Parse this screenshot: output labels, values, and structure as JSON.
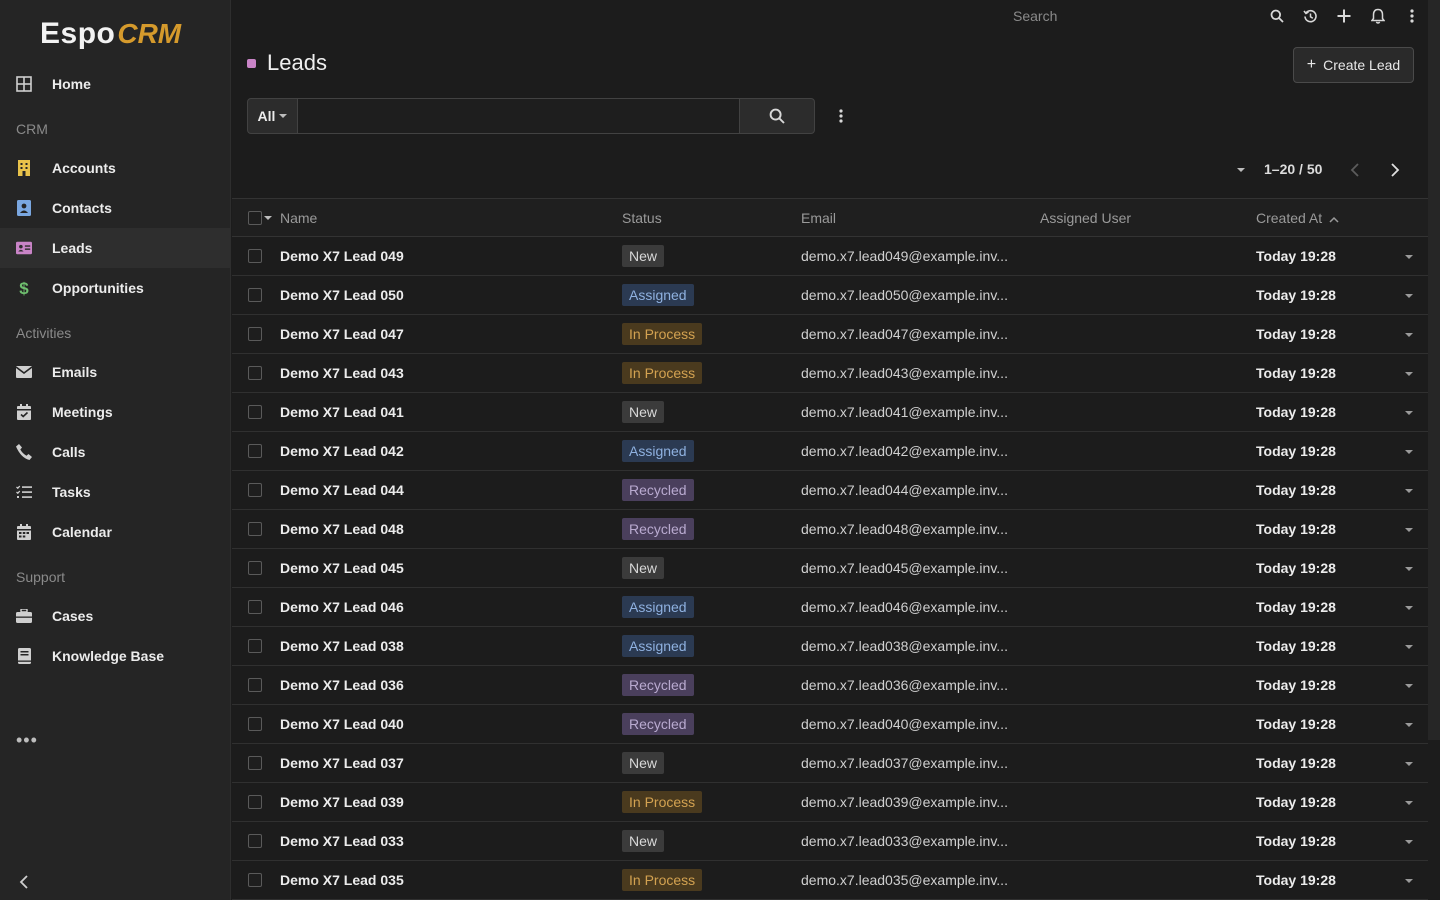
{
  "app": {
    "logo_main": "Espo",
    "logo_accent": "CRM"
  },
  "colors": {
    "accent": "#d59a2c",
    "leads_dot": "#c984c7",
    "accounts_icon": "#e8c24a",
    "contacts_icon": "#7aa7e0",
    "leads_icon": "#c984c7",
    "opportunities_icon": "#6fbf6f"
  },
  "sidebar": {
    "home": {
      "label": "Home",
      "icon": "grid-icon"
    },
    "groups": [
      {
        "label": "CRM"
      },
      {
        "label": "Activities"
      },
      {
        "label": "Support"
      }
    ],
    "items": [
      {
        "label": "Accounts",
        "icon": "building-icon"
      },
      {
        "label": "Contacts",
        "icon": "contact-card-icon"
      },
      {
        "label": "Leads",
        "icon": "id-card-icon"
      },
      {
        "label": "Opportunities",
        "icon": "dollar-icon"
      },
      {
        "label": "Emails",
        "icon": "envelope-icon"
      },
      {
        "label": "Meetings",
        "icon": "calendar-check-icon"
      },
      {
        "label": "Calls",
        "icon": "phone-icon"
      },
      {
        "label": "Tasks",
        "icon": "task-list-icon"
      },
      {
        "label": "Calendar",
        "icon": "calendar-icon"
      },
      {
        "label": "Cases",
        "icon": "briefcase-icon"
      },
      {
        "label": "Knowledge Base",
        "icon": "book-icon"
      }
    ],
    "more_label": "•••"
  },
  "topbar": {
    "search_placeholder": "Search"
  },
  "header": {
    "title": "Leads",
    "create_label": "Create Lead"
  },
  "filter": {
    "preset": "All",
    "query": ""
  },
  "pagination": {
    "info": "1–20 / 50"
  },
  "table": {
    "columns": {
      "name": "Name",
      "status": "Status",
      "email": "Email",
      "assigned_user": "Assigned User",
      "created_at": "Created At"
    },
    "rows": [
      {
        "name": "Demo X7 Lead 049",
        "status": "New",
        "email": "demo.x7.lead049@example.inv...",
        "created": "Today 19:28"
      },
      {
        "name": "Demo X7 Lead 050",
        "status": "Assigned",
        "email": "demo.x7.lead050@example.inv...",
        "created": "Today 19:28"
      },
      {
        "name": "Demo X7 Lead 047",
        "status": "In Process",
        "email": "demo.x7.lead047@example.inv...",
        "created": "Today 19:28"
      },
      {
        "name": "Demo X7 Lead 043",
        "status": "In Process",
        "email": "demo.x7.lead043@example.inv...",
        "created": "Today 19:28"
      },
      {
        "name": "Demo X7 Lead 041",
        "status": "New",
        "email": "demo.x7.lead041@example.inv...",
        "created": "Today 19:28"
      },
      {
        "name": "Demo X7 Lead 042",
        "status": "Assigned",
        "email": "demo.x7.lead042@example.inv...",
        "created": "Today 19:28"
      },
      {
        "name": "Demo X7 Lead 044",
        "status": "Recycled",
        "email": "demo.x7.lead044@example.inv...",
        "created": "Today 19:28"
      },
      {
        "name": "Demo X7 Lead 048",
        "status": "Recycled",
        "email": "demo.x7.lead048@example.inv...",
        "created": "Today 19:28"
      },
      {
        "name": "Demo X7 Lead 045",
        "status": "New",
        "email": "demo.x7.lead045@example.inv...",
        "created": "Today 19:28"
      },
      {
        "name": "Demo X7 Lead 046",
        "status": "Assigned",
        "email": "demo.x7.lead046@example.inv...",
        "created": "Today 19:28"
      },
      {
        "name": "Demo X7 Lead 038",
        "status": "Assigned",
        "email": "demo.x7.lead038@example.inv...",
        "created": "Today 19:28"
      },
      {
        "name": "Demo X7 Lead 036",
        "status": "Recycled",
        "email": "demo.x7.lead036@example.inv...",
        "created": "Today 19:28"
      },
      {
        "name": "Demo X7 Lead 040",
        "status": "Recycled",
        "email": "demo.x7.lead040@example.inv...",
        "created": "Today 19:28"
      },
      {
        "name": "Demo X7 Lead 037",
        "status": "New",
        "email": "demo.x7.lead037@example.inv...",
        "created": "Today 19:28"
      },
      {
        "name": "Demo X7 Lead 039",
        "status": "In Process",
        "email": "demo.x7.lead039@example.inv...",
        "created": "Today 19:28"
      },
      {
        "name": "Demo X7 Lead 033",
        "status": "New",
        "email": "demo.x7.lead033@example.inv...",
        "created": "Today 19:28"
      },
      {
        "name": "Demo X7 Lead 035",
        "status": "In Process",
        "email": "demo.x7.lead035@example.inv...",
        "created": "Today 19:28"
      }
    ]
  }
}
